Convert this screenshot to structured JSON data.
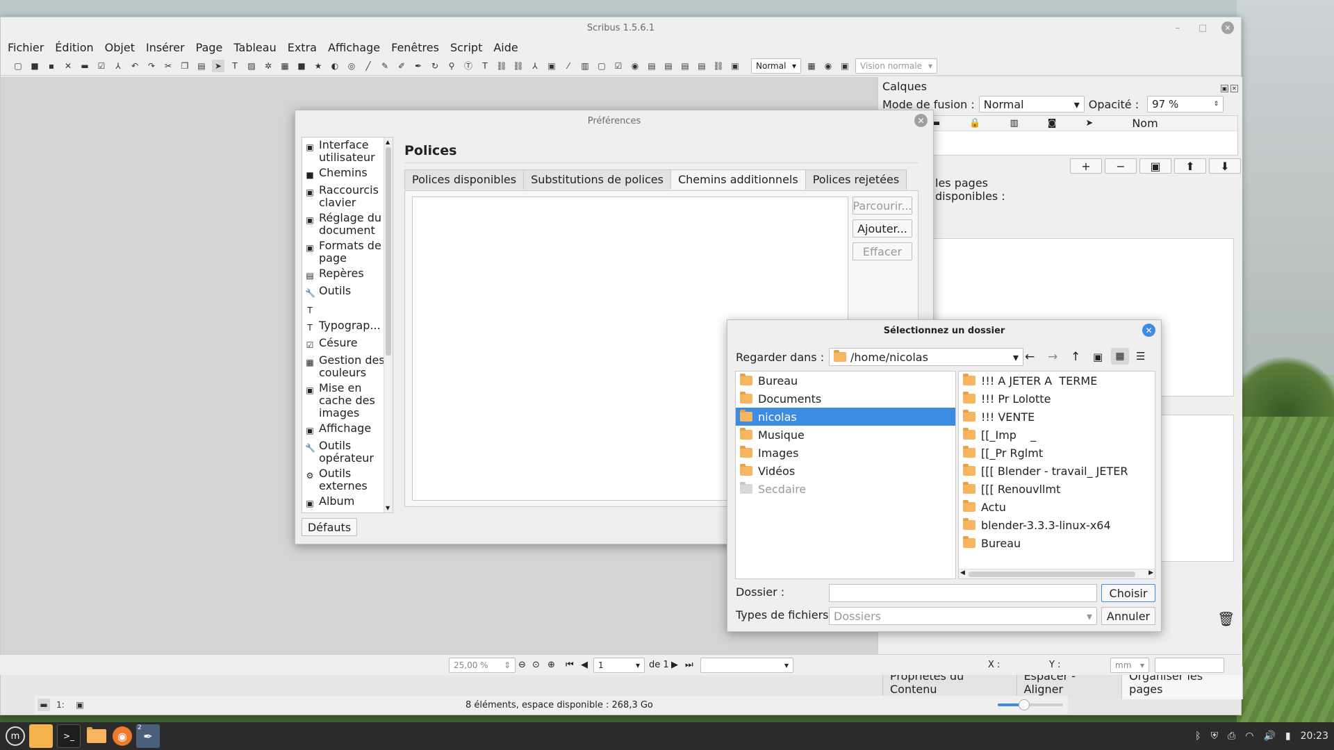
{
  "app": {
    "title": "Scribus 1.5.6.1",
    "min": "–",
    "max": "□",
    "close": "✕"
  },
  "menu": [
    "Fichier",
    "Édition",
    "Objet",
    "Insérer",
    "Page",
    "Tableau",
    "Extra",
    "Affichage",
    "Fenêtres",
    "Script",
    "Aide"
  ],
  "toolbar": {
    "mode_combo": "Normal",
    "vision_combo": "Vision normale"
  },
  "layers": {
    "title": "Calques",
    "blend_label": "Mode de fusion :",
    "blend_value": "Normal",
    "opacity_label": "Opacité :",
    "opacity_value": "97 %",
    "col_name": "Nom",
    "add": "+",
    "remove": "−"
  },
  "pages_panel": {
    "line1": "les pages",
    "line2": "disponibles :"
  },
  "bottom_tabs": [
    "Propriétés du Contenu",
    "Espacer - Aligner",
    "Organiser les pages"
  ],
  "statusnav": {
    "zoom": "25,00 %",
    "page": "1",
    "of": "de 1",
    "x_label": "X :",
    "y_label": "Y :",
    "unit": "mm"
  },
  "statusbar": {
    "text": "8 éléments, espace disponible : 268,3 Go",
    "zoom_pct": 0.4
  },
  "prefs": {
    "title": "Préférences",
    "section_title": "Polices",
    "defaults_btn": "Défauts",
    "nav": [
      {
        "icon": "▣",
        "label": "Interface utilisateur"
      },
      {
        "icon": "■",
        "label": "Chemins"
      },
      {
        "icon": "▣",
        "label": "Raccourcis clavier"
      },
      {
        "icon": "▣",
        "label": "Réglage du document"
      },
      {
        "icon": "▣",
        "label": "Formats de page"
      },
      {
        "icon": "▤",
        "label": "Repères"
      },
      {
        "icon": "🔧",
        "label": "Outils"
      },
      {
        "icon": "T",
        "label": ""
      },
      {
        "icon": "T",
        "label": "Typograp..."
      },
      {
        "icon": "☑",
        "label": "Césure"
      },
      {
        "icon": "▦",
        "label": "Gestion des couleurs"
      },
      {
        "icon": "▣",
        "label": "Mise en cache des images"
      },
      {
        "icon": "▣",
        "label": "Affichage"
      },
      {
        "icon": "🔧",
        "label": "Outils opérateur"
      },
      {
        "icon": "⚙",
        "label": "Outils externes"
      },
      {
        "icon": "▣",
        "label": "Album"
      }
    ],
    "tabs": [
      "Polices disponibles",
      "Substitutions de polices",
      "Chemins additionnels",
      "Polices rejetées"
    ],
    "active_tab": 2,
    "buttons": {
      "browse": "Parcourir...",
      "add": "Ajouter...",
      "clear": "Effacer"
    }
  },
  "filedlg": {
    "title": "Sélectionnez un dossier",
    "look_in_label": "Regarder dans :",
    "path": "/home/nicolas",
    "places": [
      {
        "label": "Bureau",
        "sel": false,
        "grey": false
      },
      {
        "label": "Documents",
        "sel": false,
        "grey": false
      },
      {
        "label": "nicolas",
        "sel": true,
        "grey": false
      },
      {
        "label": "Musique",
        "sel": false,
        "grey": false
      },
      {
        "label": "Images",
        "sel": false,
        "grey": false
      },
      {
        "label": "Vidéos",
        "sel": false,
        "grey": false
      },
      {
        "label": "Secdaire",
        "sel": false,
        "grey": true
      }
    ],
    "entries": [
      "!!! A JETER A  TERME",
      "!!! Pr Lolotte",
      "!!! VENTE",
      "[[_Imp    _",
      "[[_Pr Rglmt",
      "[[[ Blender - travail_ JETER",
      "[[[ Renouvllmt",
      "Actu",
      "blender-3.3.3-linux-x64",
      "Bureau"
    ],
    "folder_label": "Dossier :",
    "folder_value": "",
    "types_label": "Types de fichiers :",
    "types_value": "Dossiers",
    "choose": "Choisir",
    "cancel": "Annuler"
  },
  "taskbar": {
    "clock": "20:23",
    "badge": "2"
  }
}
